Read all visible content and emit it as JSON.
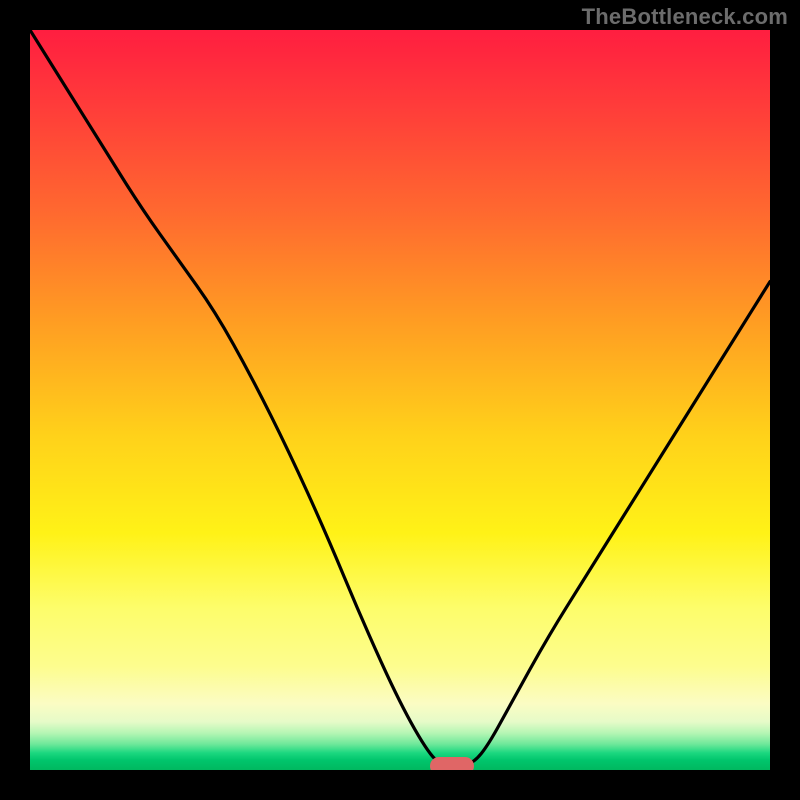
{
  "watermark": "TheBottleneck.com",
  "colors": {
    "background": "#000000",
    "watermark": "#6c6c6c",
    "curve": "#000000",
    "marker": "#e06666",
    "gradient_top": "#ff1e40",
    "gradient_bottom": "#00b85f"
  },
  "chart_data": {
    "type": "line",
    "title": "",
    "xlabel": "",
    "ylabel": "",
    "xlim": [
      0,
      100
    ],
    "ylim": [
      0,
      100
    ],
    "grid": false,
    "legend": false,
    "series": [
      {
        "name": "bottleneck-curve",
        "x": [
          0,
          5,
          10,
          15,
          20,
          25,
          30,
          35,
          40,
          45,
          50,
          54,
          56,
          58,
          60,
          62,
          65,
          70,
          75,
          80,
          85,
          90,
          95,
          100
        ],
        "y": [
          100,
          92,
          84,
          76,
          69,
          62,
          53,
          43,
          32,
          20,
          9,
          2,
          0.5,
          0.5,
          1,
          3.5,
          9,
          18,
          26,
          34,
          42,
          50,
          58,
          66
        ]
      }
    ],
    "marker": {
      "x_center": 57,
      "y": 0.5,
      "width": 6,
      "height": 2.4
    },
    "notes": "Background is a vertical heat gradient (red at top through orange/yellow to green at bottom). The black V-shaped curve represents bottleneck magnitude; the small rounded pink pill at the valley marks the balanced configuration."
  }
}
